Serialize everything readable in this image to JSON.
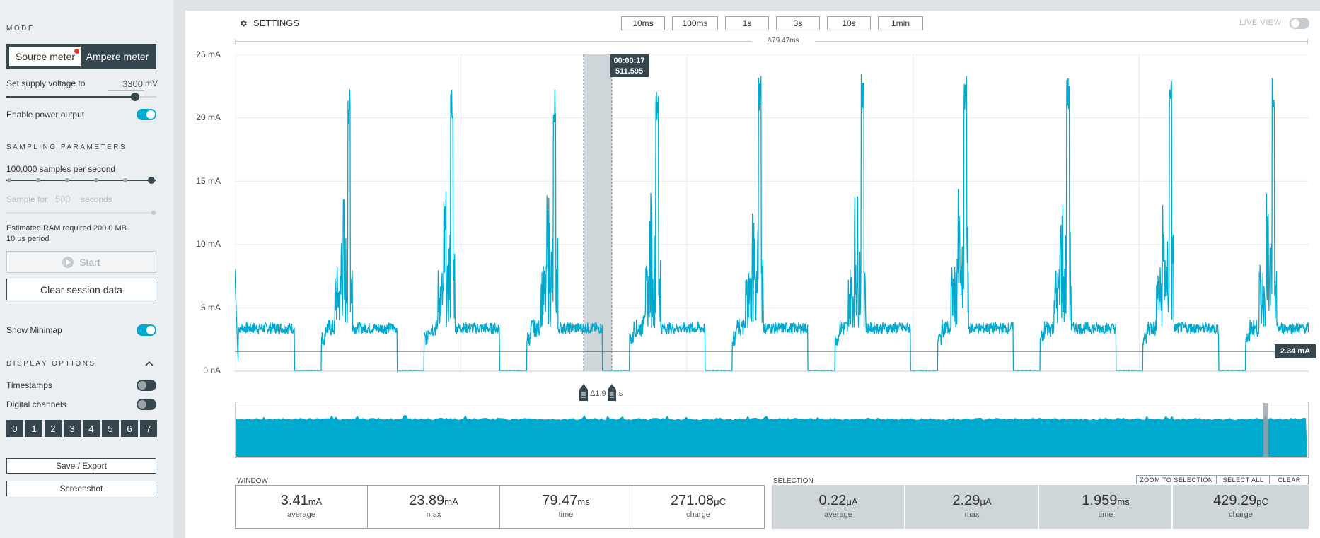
{
  "sidebar": {
    "mode_title": "MODE",
    "mode_source": "Source meter",
    "mode_ampere": "Ampere meter",
    "supply_label": "Set supply voltage to",
    "supply_value": "3300",
    "supply_unit": "mV",
    "supply_slider_fraction": 0.86,
    "enable_power": "Enable power output",
    "enable_power_on": true,
    "sampling_title": "SAMPLING PARAMETERS",
    "samples_label": "100,000 samples per second",
    "sample_for_prefix": "Sample for",
    "sample_for_value": "500",
    "sample_for_suffix": "seconds",
    "ram_label": "Estimated RAM required 200.0 MB",
    "period_label": "10 us period",
    "start_label": "Start",
    "clear_label": "Clear session data",
    "minimap_label": "Show Minimap",
    "minimap_on": true,
    "display_title": "DISPLAY OPTIONS",
    "timestamps_label": "Timestamps",
    "timestamps_on": false,
    "digital_label": "Digital channels",
    "digital_on": false,
    "channels": [
      "0",
      "1",
      "2",
      "3",
      "4",
      "5",
      "6",
      "7"
    ],
    "save_label": "Save / Export",
    "screenshot_label": "Screenshot"
  },
  "toolbar": {
    "settings_label": "SETTINGS",
    "windows": [
      "10ms",
      "100ms",
      "1s",
      "3s",
      "10s",
      "1min"
    ],
    "live_view_label": "LIVE VIEW",
    "delta_window": "Δ79.47ms"
  },
  "chart_data": {
    "type": "line",
    "title": "",
    "xlabel": "",
    "ylabel": "",
    "y_ticks": [
      "25 mA",
      "20 mA",
      "15 mA",
      "10 mA",
      "5 mA",
      "0 nA"
    ],
    "ylim": [
      0,
      25
    ],
    "y_unit": "mA",
    "window_ms": 79.47,
    "period_ms": 7.6,
    "pulse_peaks_mA": [
      22.5,
      22.4,
      22.5,
      22.5,
      22.6,
      23.4,
      23.6,
      23.5,
      23.6,
      23.7
    ],
    "baseline_mA": 3.4,
    "sleep_mA": 0,
    "reference_line_mA": 2.34,
    "reference_label": "2.34 mA",
    "cursor_time": "00:00:17",
    "cursor_value": "511.595",
    "selection_delta": "Δ1.9",
    "selection_unit": "ms",
    "grid": true
  },
  "window_stats": {
    "title": "WINDOW",
    "items": [
      {
        "value": "3.41",
        "unit": "mA",
        "label": "average"
      },
      {
        "value": "23.89",
        "unit": "mA",
        "label": "max"
      },
      {
        "value": "79.47",
        "unit": "ms",
        "label": "time"
      },
      {
        "value": "271.08",
        "unit": "μC",
        "label": "charge"
      }
    ]
  },
  "selection_stats": {
    "title": "SELECTION",
    "zoom_label": "ZOOM TO SELECTION",
    "select_all_label": "SELECT ALL",
    "clear_label": "CLEAR",
    "items": [
      {
        "value": "0.22",
        "unit": "μA",
        "label": "average"
      },
      {
        "value": "2.29",
        "unit": "μA",
        "label": "max"
      },
      {
        "value": "1.959",
        "unit": "ms",
        "label": "time"
      },
      {
        "value": "429.29",
        "unit": "pC",
        "label": "charge"
      }
    ]
  },
  "colors": {
    "accent": "#00a9ce",
    "dark": "#37474f",
    "selection": "#cfd6da"
  }
}
